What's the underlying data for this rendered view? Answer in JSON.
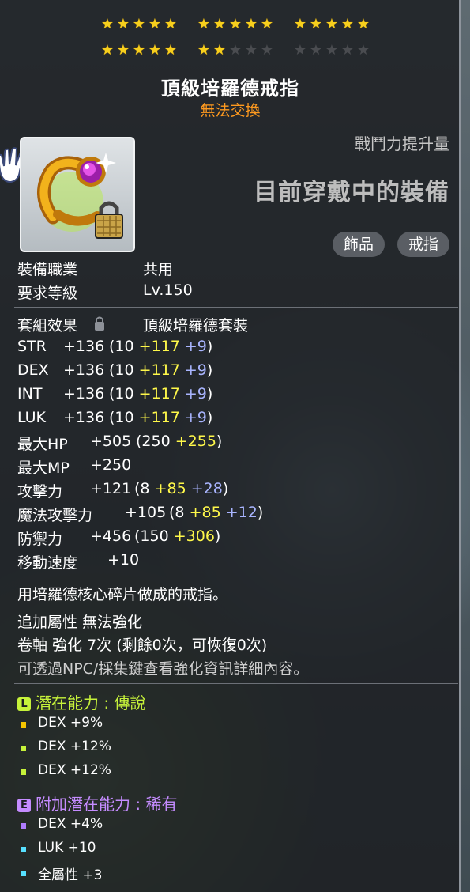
{
  "stars": {
    "row1": [
      true,
      true,
      true,
      true,
      true,
      true,
      true,
      true,
      true,
      true,
      true,
      true,
      true,
      true,
      true
    ],
    "row2": [
      true,
      true,
      true,
      true,
      true,
      true,
      true,
      false,
      false,
      false,
      false,
      false,
      false,
      false,
      false
    ]
  },
  "item": {
    "name": "頂級培羅德戒指",
    "trade_status": "無法交換"
  },
  "header": {
    "power_label": "戰鬥力提升量",
    "equipped_text": "目前穿戴中的裝備",
    "tags": [
      "飾品",
      "戒指"
    ]
  },
  "requirements": {
    "job_label": "裝備職業",
    "job_value": "共用",
    "level_label": "要求等級",
    "level_value": "Lv.150"
  },
  "set": {
    "label": "套組效果",
    "value": "頂級培羅德套裝"
  },
  "stats": [
    {
      "name": "STR",
      "total": "+136",
      "base": "10",
      "bonus": "+117",
      "enhance": "+9"
    },
    {
      "name": "DEX",
      "total": "+136",
      "base": "10",
      "bonus": "+117",
      "enhance": "+9"
    },
    {
      "name": "INT",
      "total": "+136",
      "base": "10",
      "bonus": "+117",
      "enhance": "+9"
    },
    {
      "name": "LUK",
      "total": "+136",
      "base": "10",
      "bonus": "+117",
      "enhance": "+9"
    }
  ],
  "hp": {
    "name": "最大HP",
    "total": "+505",
    "base": "250",
    "bonus": "+255"
  },
  "mp": {
    "name": "最大MP",
    "total": "+250"
  },
  "attack": {
    "name": "攻擊力",
    "total": "+121",
    "base": "8",
    "bonus": "+85",
    "enhance": "+28"
  },
  "magic": {
    "name": "魔法攻擊力",
    "total": "+105",
    "base": "8",
    "bonus": "+85",
    "enhance": "+12"
  },
  "defense": {
    "name": "防禦力",
    "total": "+456",
    "base": "150",
    "bonus": "+306"
  },
  "speed": {
    "name": "移動速度",
    "total": "+10"
  },
  "description": "用培羅德核心碎片做成的戒指。",
  "extra": {
    "line1": "追加屬性 無法強化",
    "line2": "卷軸 強化 7次 (剩餘0次，可恢復0次)",
    "line3": "可透過NPC/採集鍵查看強化資訊詳細內容。"
  },
  "potential": {
    "badge": "L",
    "title": "潛在能力 : 傳說",
    "color": "#c6f23a",
    "lines": [
      "DEX +9%",
      "DEX +12%",
      "DEX +12%"
    ],
    "bullet_colors": [
      "#f5c400",
      "#c6f23a",
      "#c6f23a"
    ]
  },
  "additional_potential": {
    "badge": "E",
    "title": "附加潛在能力 : 稀有",
    "color": "#c58cff",
    "lines": [
      "DEX +4%",
      "LUK +10",
      "全屬性 +3"
    ],
    "bullet_colors": [
      "#b07cff",
      "#57e0ff",
      "#57e0ff"
    ]
  }
}
